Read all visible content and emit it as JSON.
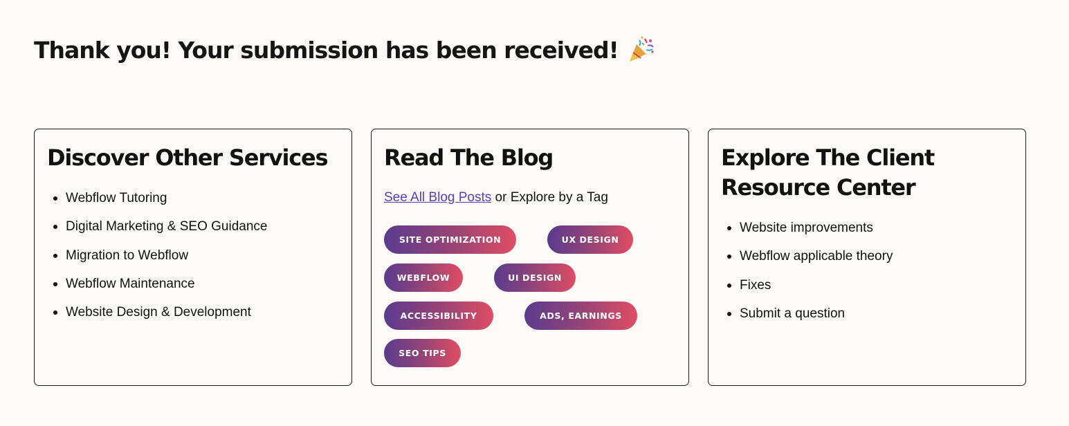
{
  "header": {
    "thank_you": "Thank you! Your submission has been received!",
    "icon": "party-popper-icon"
  },
  "services": {
    "title": "Discover Other Services",
    "items": [
      "Webflow Tutoring",
      "Digital Marketing & SEO Guidance",
      "Migration to Webflow",
      "Webflow Maintenance",
      "Website Design & Development"
    ]
  },
  "blog": {
    "title": "Read The Blog",
    "link_text": "See All Blog Posts",
    "suffix_text": " or Explore by a Tag",
    "tags": [
      "SITE OPTIMIZATION",
      "UX DESIGN",
      "WEBFLOW",
      "UI DESIGN",
      "ACCESSIBILITY",
      "ADS, EARNINGS",
      "SEO TIPS"
    ]
  },
  "resources": {
    "title": "Explore The Client Resource Center",
    "items": [
      "Website improvements",
      "Webflow applicable theory",
      "Fixes",
      "Submit a question"
    ]
  },
  "colors": {
    "background": "#fbfaf6",
    "link": "#5b3cc4",
    "tag_gradient_start": "#5a3b8e",
    "tag_gradient_end": "#e04d63"
  }
}
